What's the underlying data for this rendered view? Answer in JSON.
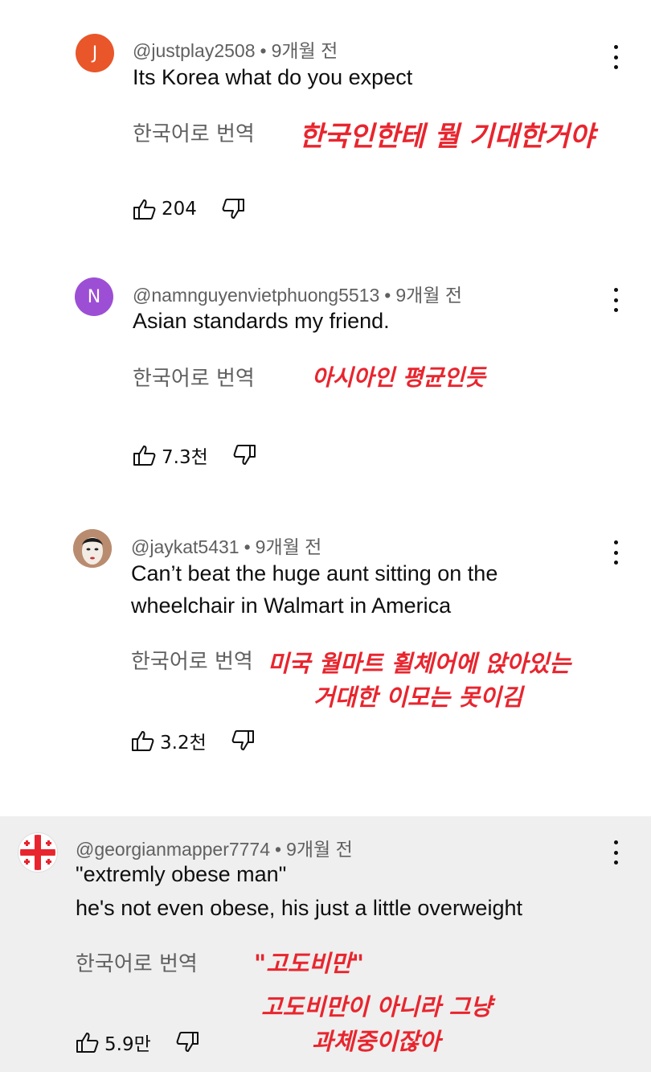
{
  "comments": [
    {
      "author": "@justplay2508",
      "time": "9개월 전",
      "avatar_letter": "J",
      "avatar_color": "#e8562a",
      "lines": [
        "Its Korea what do you expect"
      ],
      "translate_label": "한국어로 번역",
      "annotation": [
        "한국인한테 뭘 기대한거야"
      ],
      "likes": "204"
    },
    {
      "author": "@namnguyenvietphuong5513",
      "time": "9개월 전",
      "avatar_letter": "N",
      "avatar_color": "#9c4fd4",
      "lines": [
        "Asian standards my friend."
      ],
      "translate_label": "한국어로 번역",
      "annotation": [
        "아시아인 평균인듯"
      ],
      "likes": "7.3천"
    },
    {
      "author": "@jaykat5431",
      "time": "9개월 전",
      "avatar_letter": "",
      "avatar_color": "#c9a48a",
      "lines": [
        "Can’t beat the huge aunt sitting on the",
        "wheelchair in Walmart in America"
      ],
      "translate_label": "한국어로 번역",
      "annotation": [
        "미국 월마트 휠체어에 앉아있는",
        "거대한 이모는 못이김"
      ],
      "likes": "3.2천"
    },
    {
      "author": "@georgianmapper7774",
      "time": "9개월 전",
      "avatar_letter": "",
      "avatar_color": "#ffffff",
      "lines": [
        "\"extremly obese man\"",
        "he's not even obese, his just a little overweight"
      ],
      "translate_label": "한국어로 번역",
      "annotation": [
        "\"고도비만\"",
        "고도비만이 아니라 그냥",
        "과체중이잖아"
      ],
      "likes": "5.9만"
    }
  ],
  "colors": {
    "annotation": "#e8252e",
    "meta": "#606060",
    "highlight_bg": "#efefef"
  },
  "icons": {
    "like": "thumbs-up-icon",
    "dislike": "thumbs-down-icon",
    "more": "more-vert-icon"
  }
}
